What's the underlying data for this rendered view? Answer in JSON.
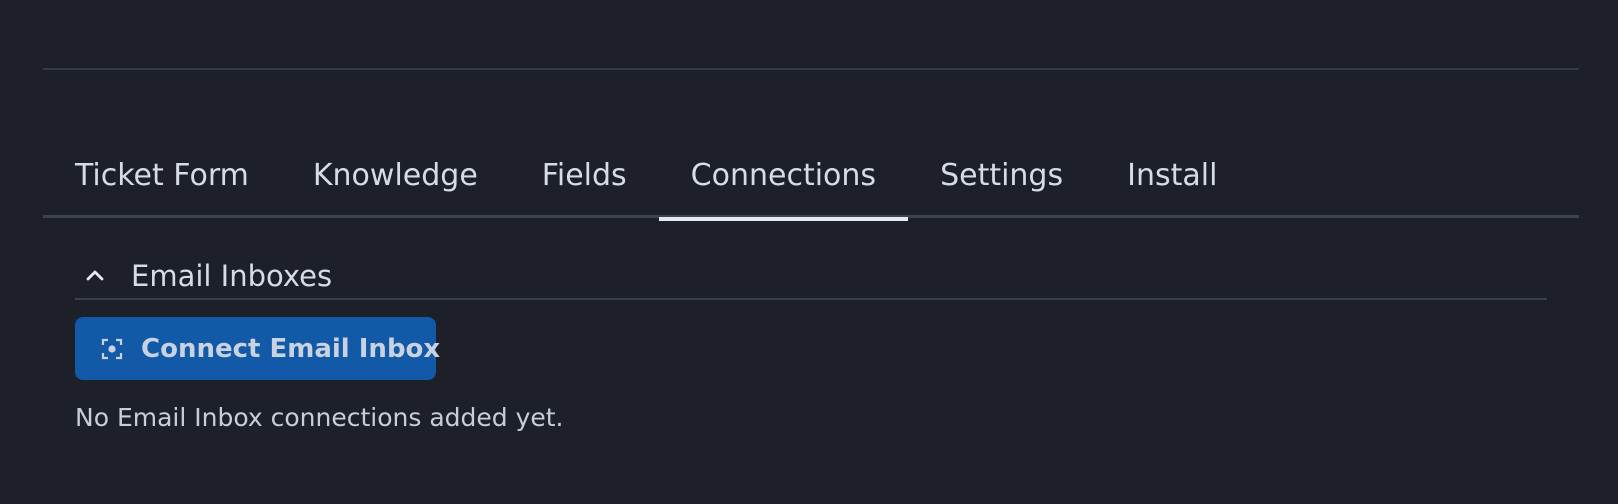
{
  "tabs": [
    {
      "label": "Ticket Form",
      "active": false
    },
    {
      "label": "Knowledge",
      "active": false
    },
    {
      "label": "Fields",
      "active": false
    },
    {
      "label": "Connections",
      "active": true
    },
    {
      "label": "Settings",
      "active": false
    },
    {
      "label": "Install",
      "active": false
    }
  ],
  "section": {
    "title": "Email Inboxes",
    "expanded": true,
    "toggle_icon": "chevron-up-icon"
  },
  "connect_button": {
    "label": "Connect Email Inbox",
    "icon": "focus-frame-icon",
    "color": "#1259a8"
  },
  "empty_state": {
    "text": "No Email Inbox connections added yet."
  },
  "colors": {
    "background": "#1d2028",
    "active_tab_underline": "#e6eaf0",
    "text": "#d7dce4"
  }
}
